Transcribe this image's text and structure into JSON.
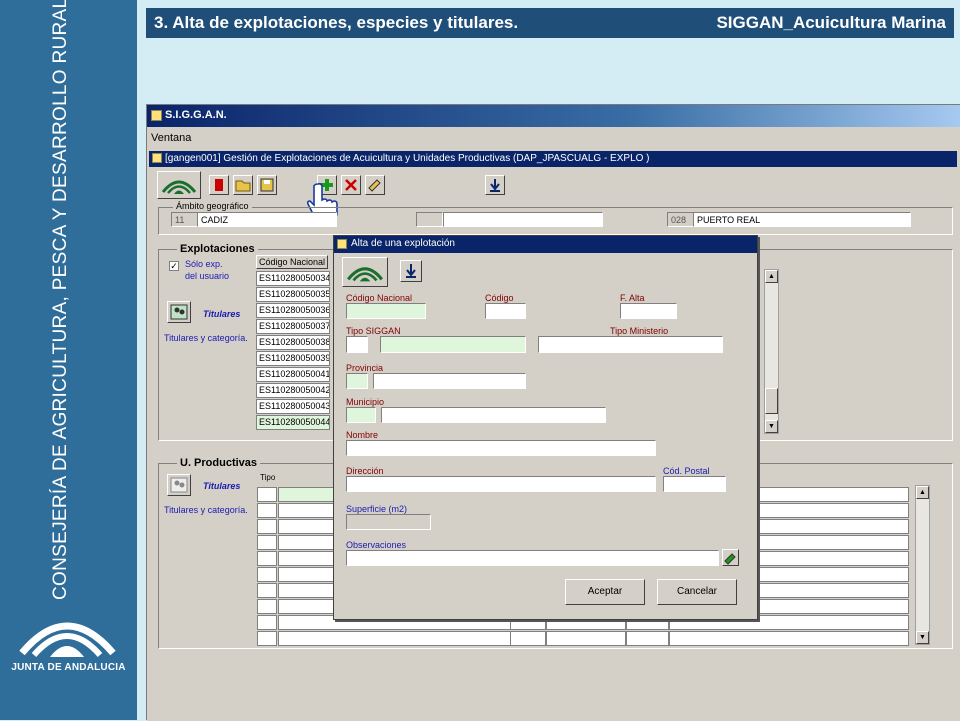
{
  "header": {
    "left": "3. Alta de explotaciones, especies y titulares.",
    "right": "SIGGAN_Acuicultura Marina"
  },
  "sidebar": {
    "vertical_text": "CONSEJERÍA DE AGRICULTURA, PESCA Y DESARROLLO RURAL",
    "logo_text": "JUNTA DE ANDALUCIA"
  },
  "app": {
    "title": "S.I.G.G.A.N.",
    "menu": "Ventana",
    "inner_title": "[gangen001] Gestión de Explotaciones de Acuicultura y Unidades Productivas (DAP_JPASCUALG - EXPLO )",
    "ambito": {
      "label": "Ámbito geográfico",
      "code1": "11",
      "name1": "CADIZ",
      "code3": "028",
      "name3": "PUERTO REAL"
    },
    "explotaciones": {
      "label": "Explotaciones",
      "checkbox_label_1": "Sólo exp.",
      "checkbox_label_2": "del usuario",
      "titulares": "Titulares",
      "titulares_cat": "Titulares y categoría.",
      "column": "Código Nacional",
      "rows": [
        "ES110280050034",
        "ES110280050035",
        "ES110280050036",
        "ES110280050037",
        "ES110280050038",
        "ES110280050039",
        "ES110280050041",
        "ES110280050042",
        "ES110280050043",
        "ES110280050044"
      ]
    },
    "productivas": {
      "label": "U. Productivas",
      "titulares": "Titulares",
      "titulares_cat": "Titulares y categoría.",
      "col_tipo": "Tipo"
    }
  },
  "dialog": {
    "title": "Alta de una explotación",
    "codigo_nacional": "Código Nacional",
    "codigo": "Código",
    "f_alta": "F. Alta",
    "tipo_siggan": "Tipo SIGGAN",
    "tipo_ministerio": "Tipo Ministerio",
    "provincia": "Provincia",
    "municipio": "Municipio",
    "nombre": "Nombre",
    "direccion": "Dirección",
    "cod_postal": "Cód. Postal",
    "superficie": "Superficie  (m2)",
    "observaciones": "Observaciones",
    "aceptar": "Aceptar",
    "cancelar": "Cancelar"
  }
}
